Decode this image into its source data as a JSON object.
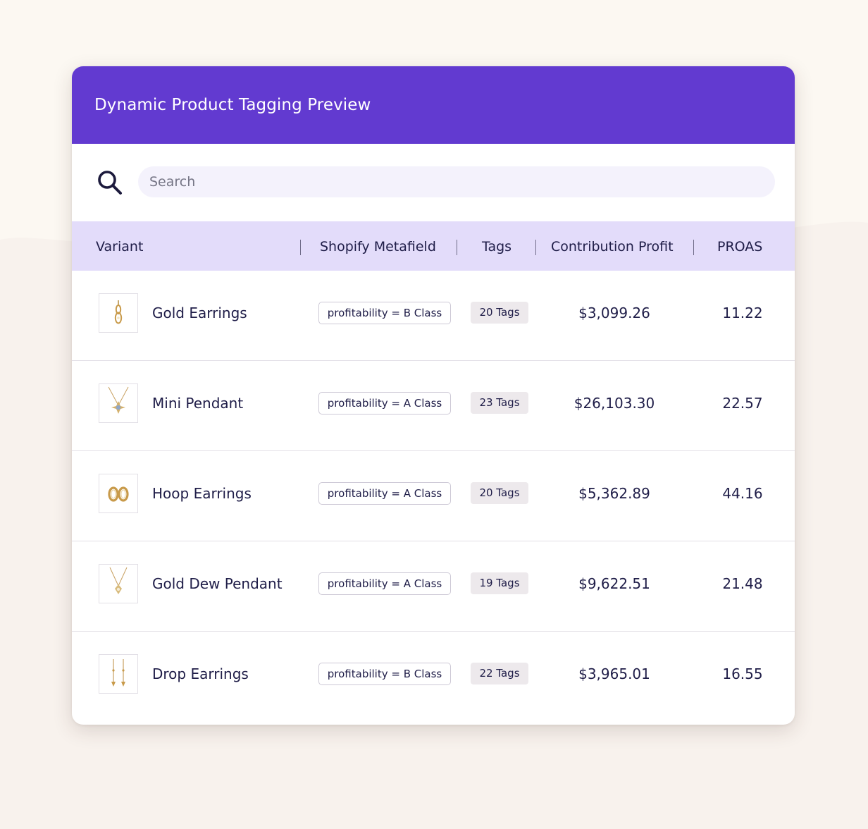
{
  "header": {
    "title": "Dynamic Product Tagging Preview"
  },
  "search": {
    "placeholder": "Search",
    "value": ""
  },
  "columns": {
    "variant": "Variant",
    "metafield": "Shopify Metafield",
    "tags": "Tags",
    "profit": "Contribution Profit",
    "proas": "PROAS"
  },
  "rows": [
    {
      "variant": "Gold Earrings",
      "metafield": "profitability = B Class",
      "tags": "20 Tags",
      "profit": "$3,099.26",
      "proas": "11.22",
      "icon": "gold-earrings-thumbnail"
    },
    {
      "variant": "Mini Pendant",
      "metafield": "profitability = A Class",
      "tags": "23 Tags",
      "profit": "$26,103.30",
      "proas": "22.57",
      "icon": "mini-pendant-thumbnail"
    },
    {
      "variant": "Hoop Earrings",
      "metafield": "profitability = A Class",
      "tags": "20 Tags",
      "profit": "$5,362.89",
      "proas": "44.16",
      "icon": "hoop-earrings-thumbnail"
    },
    {
      "variant": "Gold Dew Pendant",
      "metafield": "profitability = A Class",
      "tags": "19 Tags",
      "profit": "$9,622.51",
      "proas": "21.48",
      "icon": "gold-dew-pendant-thumbnail"
    },
    {
      "variant": "Drop Earrings",
      "metafield": "profitability = B Class",
      "tags": "22 Tags",
      "profit": "$3,965.01",
      "proas": "16.55",
      "icon": "drop-earrings-thumbnail"
    }
  ],
  "colors": {
    "header_bg": "#623ad0",
    "table_head_bg": "#e3dcfa",
    "search_bg": "#f4f2fc",
    "text": "#1f1d48",
    "page_bg": "#fcf8f2",
    "tag_bg": "#ede9ec"
  }
}
